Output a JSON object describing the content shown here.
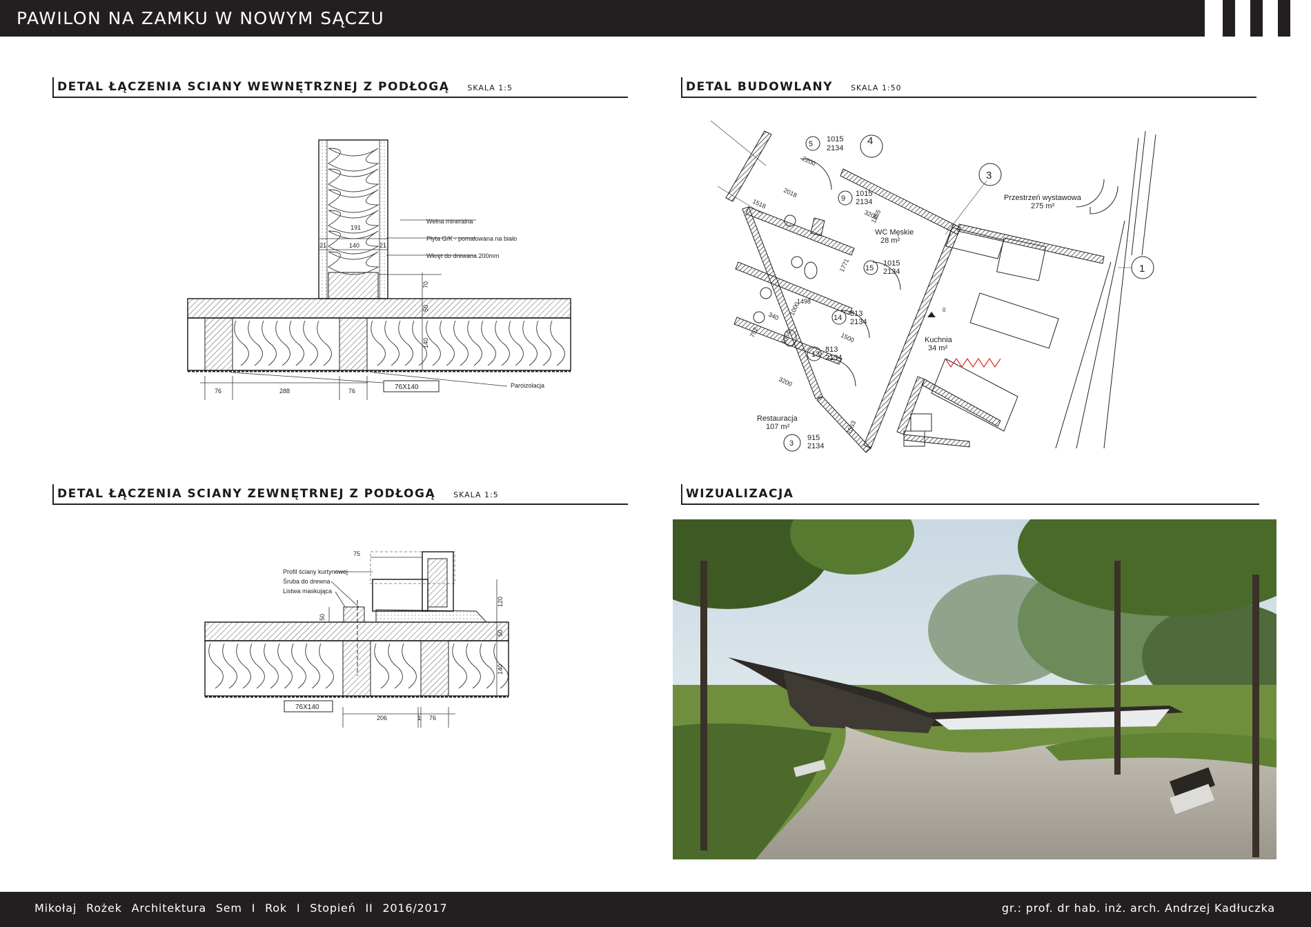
{
  "header": {
    "title": "PAWILON NA ZAMKU W NOWYM SĄCZU",
    "stripes": 3
  },
  "sections": {
    "inner_wall": {
      "title": "DETAL ŁĄCZENIA SCIANY WEWNĘTRZNEJ Z PODŁOGĄ",
      "scale": "SKALA 1:5"
    },
    "building": {
      "title": "DETAL BUDOWLANY",
      "scale": "SKALA 1:50"
    },
    "outer_wall": {
      "title": "DETAL ŁĄCZENIA SCIANY ZEWNĘTRNEJ Z PODŁOGĄ",
      "scale": "SKALA 1:5"
    },
    "visualization": {
      "title": "WIZUALIZACJA",
      "scale": ""
    }
  },
  "inner_detail": {
    "labels": {
      "wool": "Wełna mineralna",
      "board": "Płyta G/K - pomalowana  na biało",
      "screw": "Wkręt do drewana  200mm",
      "vapor": "Paroizolacja",
      "beam": "76X140"
    },
    "dims": {
      "d191": "191",
      "d140": "140",
      "d21a": "21",
      "d21b": "21",
      "d70": "70",
      "d50": "50",
      "d140v": "140",
      "d76a": "76",
      "d288": "288",
      "d76b": "76"
    }
  },
  "outer_detail": {
    "labels": {
      "profile": "Profil ściany kurtynowej",
      "screw": "Śruba do drewna",
      "strip": "Listwa maskująca",
      "beam": "76X140"
    },
    "dims": {
      "d75": "75",
      "d50": "50",
      "d120": "120",
      "d50b": "50",
      "d140": "140",
      "d206": "206",
      "d1": "1",
      "d76": "76"
    }
  },
  "plan": {
    "rooms": [
      {
        "name": "Przestrzeń wystawowa",
        "area": "275 m²"
      },
      {
        "name": "WC Męskie",
        "area": "28 m²"
      },
      {
        "name": "Kuchnia",
        "area": "34 m²"
      },
      {
        "name": "Restauracja",
        "area": "107 m²"
      }
    ],
    "axes": [
      "4",
      "3",
      "1"
    ],
    "doors": [
      {
        "num": "5",
        "w": "1015",
        "h": "2134"
      },
      {
        "num": "9",
        "w": "1015",
        "h": "2134"
      },
      {
        "num": "15",
        "w": "1015",
        "h": "2134"
      },
      {
        "num": "14",
        "w": "813",
        "h": "2134"
      },
      {
        "num": "13",
        "w": "813",
        "h": "2134"
      },
      {
        "num": "3",
        "w": "915",
        "h": "2134"
      }
    ],
    "dims": [
      "2200",
      "2018",
      "1518",
      "3200",
      "1355",
      "1771",
      "1000",
      "1498",
      "340",
      "1500",
      "1064",
      "752",
      "3200",
      "1553"
    ],
    "north": "0"
  },
  "footer": {
    "left": "Mikołaj Rożek   Architektura   Sem I   Rok  I   Stopień II   2016/2017",
    "right": "gr.: prof. dr hab. inż. arch. Andrzej Kadłuczka"
  },
  "colors": {
    "dark": "#231f20",
    "accent_red": "#e03030"
  }
}
